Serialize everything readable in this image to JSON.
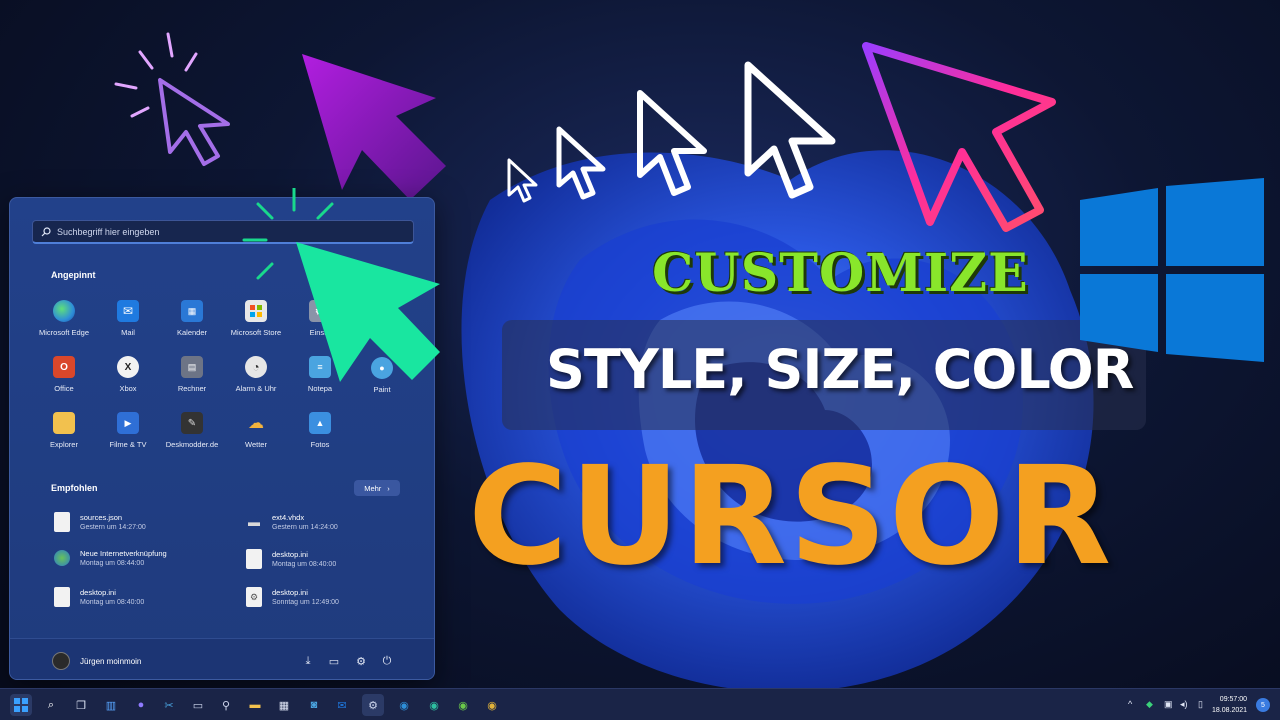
{
  "headline": {
    "customize": "CUSTOMIZE",
    "style_size_color": "STYLE, SIZE, COLOR",
    "cursor": "CURSOR"
  },
  "start_menu": {
    "search_placeholder": "Suchbegriff hier eingeben",
    "pinned_title": "Angepinnt",
    "pinned_apps": [
      {
        "label": "Microsoft Edge",
        "icon": "edge-icon",
        "color": "#2e8fd8"
      },
      {
        "label": "Mail",
        "icon": "mail-icon",
        "color": "#1f7ae0"
      },
      {
        "label": "Kalender",
        "icon": "calendar-icon",
        "color": "#2a78d6"
      },
      {
        "label": "Microsoft Store",
        "icon": "store-icon",
        "color": "#e8e8e8"
      },
      {
        "label": "Einste",
        "icon": "settings-icon",
        "color": "#8a93a8"
      },
      {
        "label": "Office",
        "icon": "office-icon",
        "color": "#d9472b"
      },
      {
        "label": "Xbox",
        "icon": "xbox-icon",
        "color": "#f2f2f2"
      },
      {
        "label": "Rechner",
        "icon": "calculator-icon",
        "color": "#6d7486"
      },
      {
        "label": "Alarm & Uhr",
        "icon": "clock-icon",
        "color": "#e6e6e6"
      },
      {
        "label": "Notepa",
        "icon": "notepad-icon",
        "color": "#4aa4e0"
      },
      {
        "label": "Explorer",
        "icon": "folder-icon",
        "color": "#f2c14e"
      },
      {
        "label": "Filme & TV",
        "icon": "film-icon",
        "color": "#2f6fd6"
      },
      {
        "label": "Deskmodder.de",
        "icon": "brush-icon",
        "color": "#333333"
      },
      {
        "label": "Wetter",
        "icon": "weather-icon",
        "color": "#f3b33d"
      },
      {
        "label": "Fotos",
        "icon": "photos-icon",
        "color": "#3b8fe0"
      }
    ],
    "paint_label": "Paint",
    "recommended_title": "Empfohlen",
    "more_label": "Mehr",
    "recommended": [
      {
        "name": "sources.json",
        "time": "Gestern um 14:27:00",
        "icon": "file-icon"
      },
      {
        "name": "ext4.vhdx",
        "time": "Gestern um 14:24:00",
        "icon": "disk-icon"
      },
      {
        "name": "Neue Internetverknüpfung",
        "time": "Montag um 08:44:00",
        "icon": "globe-icon"
      },
      {
        "name": "desktop.ini",
        "time": "Montag um 08:40:00",
        "icon": "file-icon"
      },
      {
        "name": "desktop.ini",
        "time": "Montag um 08:40:00",
        "icon": "file-icon"
      },
      {
        "name": "desktop.ini",
        "time": "Sonntag um 12:49:00",
        "icon": "settings-file-icon"
      }
    ],
    "user_name": "Jürgen moinmoin"
  },
  "taskbar": {
    "clock_time": "09:57:00",
    "clock_date": "18.08.2021",
    "notification_count": "5"
  },
  "colors": {
    "customize": "#89e62b",
    "cursor": "#f4a020",
    "windows_blue": "#0a78d7"
  }
}
